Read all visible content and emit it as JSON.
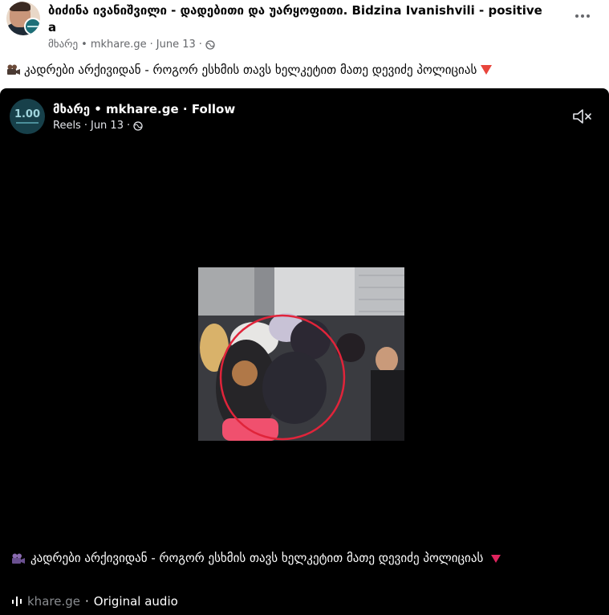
{
  "post": {
    "title": "ბიძინა ივანიშვილი - დადებითი და უარყოფითი. Bidzina Ivanishvili - positive a",
    "author": "მხარე",
    "source": "mkhare.ge",
    "date": "June 13",
    "caption": "კადრები არქივიდან - როგორ ესხმის თავს ხელკეტით მათე დევიძე პოლიციას"
  },
  "reel": {
    "avatar_text": "1.00",
    "account_name": "მხარე • mkhare.ge",
    "follow_label": "Follow",
    "section": "Reels",
    "date": "Jun 13",
    "caption": "კადრები არქივიდან - როგორ ესხმის თავს ხელკეტით მათე დევიძე პოლიციას",
    "audio_source": "khare.ge",
    "audio_label": "Original audio"
  },
  "icons": {
    "more": "more-icon",
    "globe": "globe-icon",
    "camera": "movie-camera-icon",
    "triangle": "red-triangle-icon",
    "mute": "speaker-muted-icon",
    "audio": "audio-bars-icon"
  },
  "colors": {
    "accent_red": "#e0245e",
    "muted_text": "#65676b",
    "reel_bg": "#000000"
  }
}
